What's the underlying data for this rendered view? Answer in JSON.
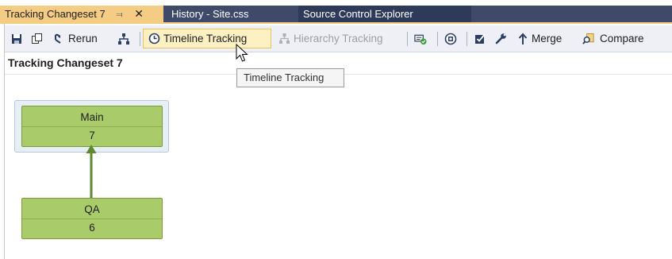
{
  "tabs": [
    {
      "label": "Tracking Changeset 7",
      "active": true
    },
    {
      "label": "History - Site.css",
      "active": false
    },
    {
      "label": "Source Control Explorer",
      "active": false
    }
  ],
  "toolbar": {
    "rerun_label": "Rerun",
    "timeline_label": "Timeline Tracking",
    "hierarchy_label": "Hierarchy Tracking",
    "merge_label": "Merge",
    "compare_label": "Compare"
  },
  "heading": "Tracking Changeset 7",
  "tooltip": "Timeline Tracking",
  "graph": {
    "nodes": [
      {
        "branch": "Main",
        "changeset": "7"
      },
      {
        "branch": "QA",
        "changeset": "6"
      }
    ]
  },
  "colors": {
    "tab_strip": "#3f4a6b",
    "active_tab": "#f5cc84",
    "node_fill": "#aacb6a",
    "arrow": "#5d8a2e",
    "toolbar_bg": "#eef0f6"
  }
}
